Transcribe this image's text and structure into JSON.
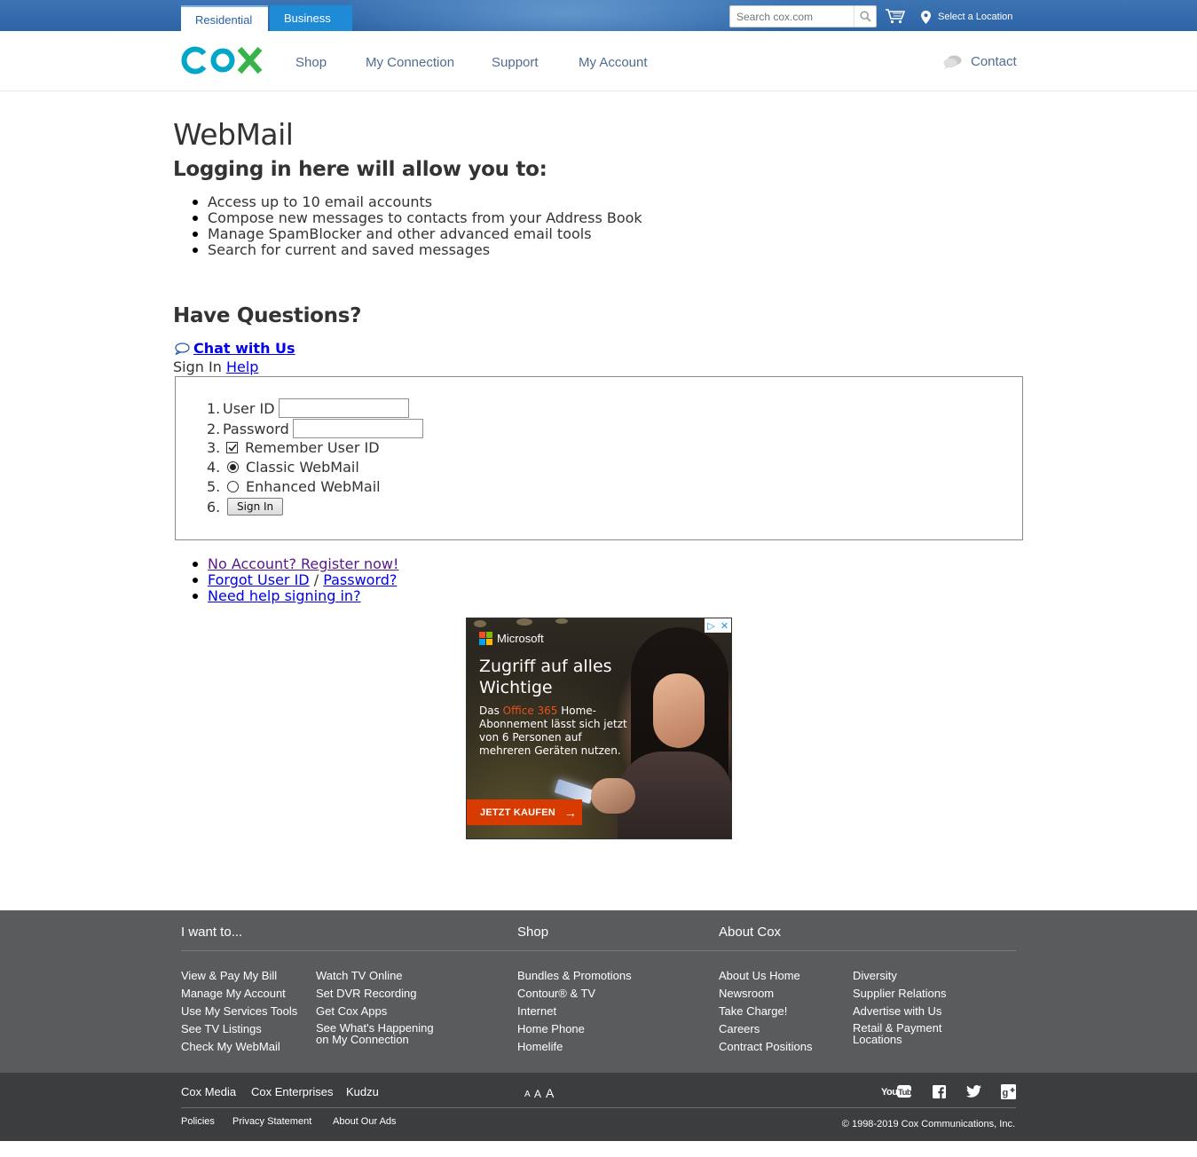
{
  "topbar": {
    "tabs": [
      "Residential",
      "Business"
    ],
    "search_placeholder": "Search cox.com",
    "location_label": "Select a Location"
  },
  "nav": {
    "logo_text": "COX",
    "items": [
      "Shop",
      "My Connection",
      "Support",
      "My Account"
    ],
    "contact_label": "Contact"
  },
  "page": {
    "title": "WebMail",
    "subtitle": "Logging in here will allow you to:",
    "benefits": [
      "Access up to 10 email accounts",
      "Compose new messages to contacts from your Address Book",
      "Manage SpamBlocker and other advanced email tools",
      "Search for current and saved messages"
    ],
    "questions_heading": "Have Questions?",
    "chat_label": " Chat with Us",
    "signin_prefix": "Sign In ",
    "help_label": "Help"
  },
  "form": {
    "numbers": [
      "1.",
      "2.",
      "3.",
      "4.",
      "5.",
      "6."
    ],
    "user_id_label": "User ID",
    "password_label": "Password",
    "remember_label": "Remember User ID",
    "remember_checked": true,
    "classic_label": "Classic WebMail",
    "enhanced_label": "Enhanced WebMail",
    "selected_mode": "classic",
    "signin_button": "Sign In"
  },
  "links": {
    "register": "No Account? Register now!",
    "forgot_user": "Forgot User ID",
    "separator": " / ",
    "forgot_password": "Password?",
    "need_help": "Need help signing in?"
  },
  "ad": {
    "brand": "Microsoft",
    "headline": "Zugriff auf alles Wichtige",
    "body_pre": "Das ",
    "body_highlight": "Office 365",
    "body_post": " Home-Abonnement lässt sich jetzt von 6 Personen auf mehreren Geräten nutzen.",
    "cta": "JETZT KAUFEN",
    "highlight_color": "#e8501c",
    "cta_color": "#d83b01"
  },
  "footer": {
    "headings": [
      "I want to...",
      "Shop",
      "About Cox"
    ],
    "col1": [
      "View & Pay My Bill",
      "Manage My Account",
      "Use My Services Tools",
      "See TV Listings",
      "Check My WebMail"
    ],
    "col2": [
      "Watch TV Online",
      "Set DVR Recording",
      "Get Cox Apps",
      "See What's Happening on My Connection"
    ],
    "col3": [
      "Bundles & Promotions",
      "Contour® & TV",
      "Internet",
      "Home Phone",
      "Homelife"
    ],
    "col4": [
      "About Us Home",
      "Newsroom",
      "Take Charge!",
      "Careers",
      "Contract Positions"
    ],
    "col5": [
      "Diversity",
      "Supplier Relations",
      "Advertise with Us",
      "Retail & Payment Locations"
    ],
    "bottom_links": [
      "Cox Media",
      "Cox Enterprises",
      "Kudzu"
    ],
    "font_sizes": [
      "A",
      "A",
      "A"
    ],
    "legal_links": [
      "Policies",
      "Privacy Statement",
      "About Our Ads"
    ],
    "copyright": "© 1998-2019 Cox Communications, Inc.",
    "social_icons": [
      "youtube-icon",
      "facebook-icon",
      "twitter-icon",
      "google-plus-icon"
    ]
  },
  "colors": {
    "topbar": "#2d64a6",
    "business_tab": "#1f8ad6",
    "logo_teal": "#00a7c8",
    "logo_green": "#36b44a",
    "footer": "#5a5b5d",
    "footer_bottom": "#3c3d3f"
  }
}
